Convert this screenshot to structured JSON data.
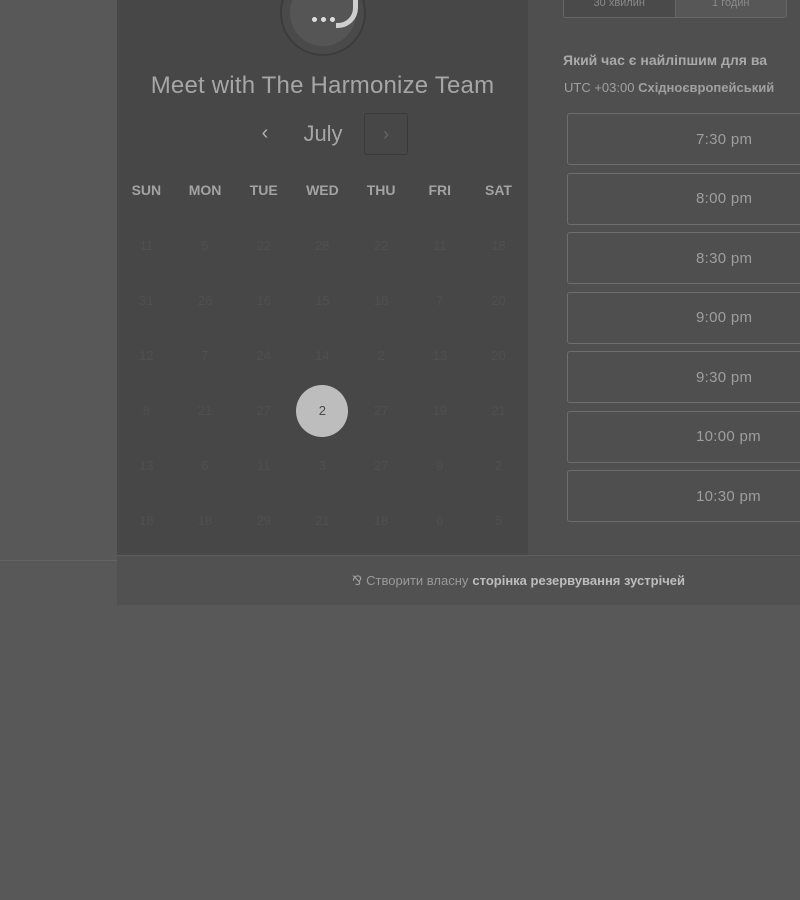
{
  "calendar": {
    "title": "Meet with The Harmonize Team",
    "month": "July",
    "prev_icon": "‹",
    "next_icon": "›",
    "days_of_week": [
      "SUN",
      "MON",
      "TUE",
      "WED",
      "THU",
      "FRI",
      "SAT"
    ],
    "weeks": [
      [
        "11",
        "5",
        "22",
        "28",
        "22",
        "11",
        "18"
      ],
      [
        "31",
        "26",
        "16",
        "15",
        "18",
        "7",
        "20"
      ],
      [
        "12",
        "7",
        "24",
        "14",
        "2",
        "13",
        "20"
      ],
      [
        "8",
        "21",
        "27",
        "2",
        "27",
        "19",
        "21"
      ],
      [
        "13",
        "6",
        "11",
        "3",
        "27",
        "9",
        "2"
      ],
      [
        "18",
        "18",
        "29",
        "21",
        "18",
        "6",
        "5"
      ]
    ],
    "selected": "2"
  },
  "duration": {
    "options": [
      "30 хвилин",
      "1 годин"
    ]
  },
  "time_panel": {
    "question": "Який час є найліпшим для ва",
    "timezone_prefix": "UTC +03:00",
    "timezone_name": "Східноєвропейський",
    "slots": [
      "7:30 pm",
      "8:00 pm",
      "8:30 pm",
      "9:00 pm",
      "9:30 pm",
      "10:00 pm",
      "10:30 pm"
    ]
  },
  "footer": {
    "icon": "sprocket-icon",
    "text": "Створити власну",
    "link": "сторінка резервування зустрічей"
  }
}
